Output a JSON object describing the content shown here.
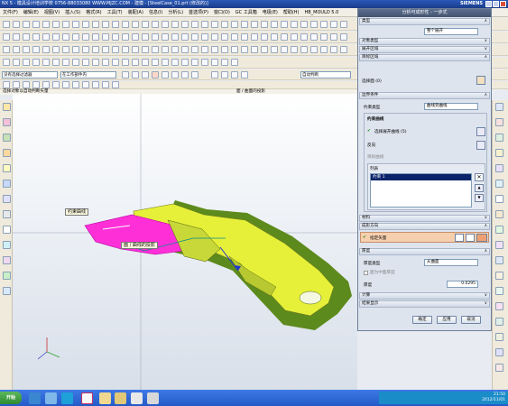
{
  "window": {
    "title": "NX 5 - 模具设计培训学校  0756-88033080  WWW.MJZC.COM - 建模 - [SteelCase_01.prt (修改的)]",
    "brand": "SIEMENS"
  },
  "menubar": [
    "文件(F)",
    "编辑(E)",
    "视图(V)",
    "插入(S)",
    "格式(R)",
    "工具(T)",
    "装配(A)",
    "信息(I)",
    "分析(L)",
    "首选项(P)",
    "窗口(O)",
    "GC 工具箱",
    "电极(E)",
    "帮助(H)",
    "HB_MOULD 5.0"
  ],
  "selection_bar": {
    "filter": "没有选择过滤器",
    "scope": "在工作部件内",
    "snap_hint": "自动判断"
  },
  "cue_line": {
    "prompt": "选择对象以自动判断矢量",
    "status": "面 / 曲面的投影"
  },
  "viewport": {
    "tooltip_curve": "约束曲线",
    "tooltip_face": "面 / 曲线的投影"
  },
  "dialog": {
    "title": "分析可成形性 - 一步式",
    "sections": {
      "type": "类型",
      "object_type": "对象类型",
      "expand_region": "展开区域",
      "target_region": "目标区域",
      "boundary": "边界条件",
      "material": "材料",
      "direction": "成形方向",
      "thickness": "厚度",
      "compute": "计算",
      "result": "结果显示"
    },
    "type_value": "整个展开",
    "select_face_label": "选择面 (0)",
    "constraint_type_label": "约束类型",
    "constraint_type_value": "曲线到曲线",
    "constraint_curve": "约束曲线",
    "select_unfold_curve": "选择展开曲线 (5)",
    "reverse_label": "反向",
    "target_curve": "目标曲线",
    "list_header": "列表",
    "list_items": [
      "约束 1"
    ],
    "specify_vector": "指定矢量",
    "thickness_type_label": "厚度类型",
    "thickness_type_value": "从曲面",
    "use_middle_face": "面为中面厚度",
    "thickness_label": "厚度",
    "thickness_value": "0.0295",
    "buttons": {
      "ok": "确定",
      "apply": "应用",
      "cancel": "取消"
    }
  },
  "taskbar": {
    "start": "开始",
    "time": "21:50",
    "date": "2012/11/01"
  },
  "colors": {
    "title_bar": "#1a3c8a",
    "part_yellow": "#e6f038",
    "part_green": "#5d8a1c",
    "magenta_face": "#ff2fd8",
    "accent_orange": "#f0a070"
  }
}
